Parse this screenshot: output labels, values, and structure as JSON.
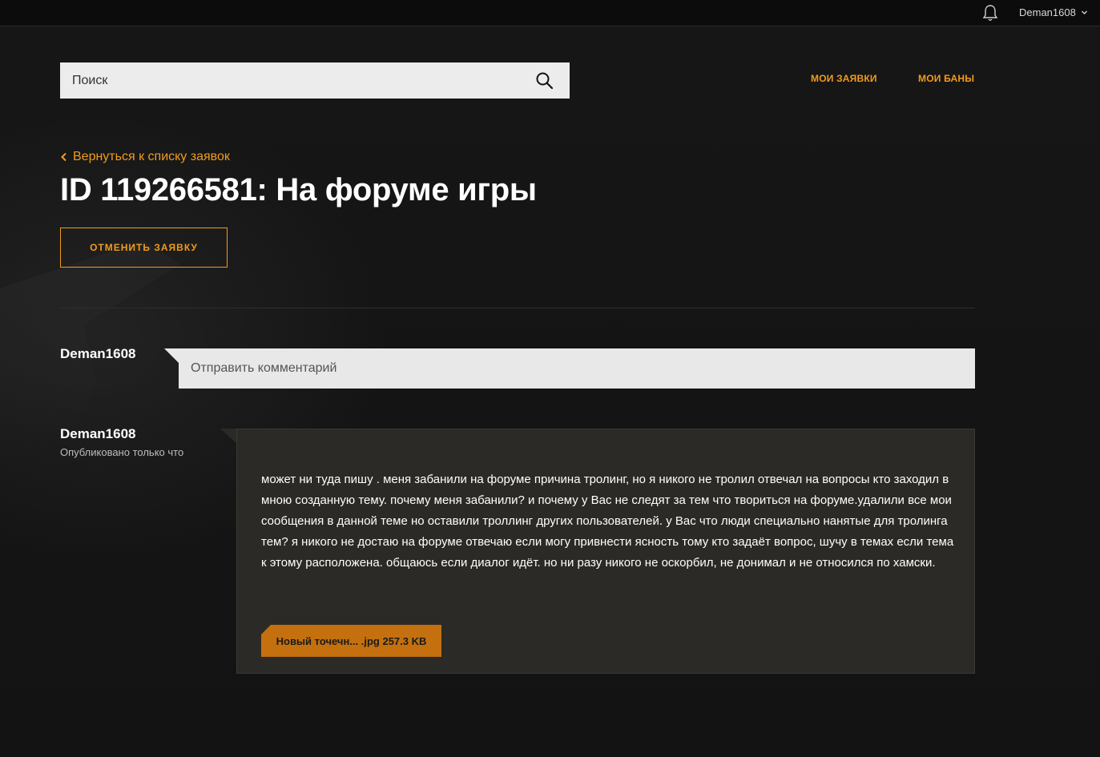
{
  "topbar": {
    "username": "Deman1608"
  },
  "search": {
    "placeholder": "Поиск"
  },
  "nav": {
    "my_requests": "МОИ ЗАЯВКИ",
    "my_bans": "МОИ БАНЫ"
  },
  "back_link": "Вернуться к списку заявок",
  "page_title": "ID 119266581: На форуме игры",
  "cancel_button": "ОТМЕНИТЬ ЗАЯВКУ",
  "composer": {
    "username": "Deman1608",
    "placeholder": "Отправить комментарий"
  },
  "post": {
    "username": "Deman1608",
    "published": "Опубликовано только что",
    "text": "может ни туда пишу . меня забанили на форуме причина тролинг, но я никого не тролил отвечал на вопросы кто заходил в мною созданную тему. почему меня забанили? и почему у Вас не следят за тем что твориться на форуме.удалили все мои сообщения в данной теме но оставили троллинг других пользователей. у Вас что люди специально нанятые для тролинга тем? я никого не достаю на форуме отвечаю если могу привнести ясность тому кто задаёт вопрос, шучу в темах если тема к этому расположена. общаюсь если диалог идёт. но ни разу никого не оскорбил, не донимал и не относился по хамски.",
    "attachment": "Новый точечн... .jpg 257.3 KB"
  },
  "colors": {
    "accent": "#f29b1c",
    "background": "#141414",
    "post_background": "#2b2a26",
    "attachment": "#c4700f"
  }
}
